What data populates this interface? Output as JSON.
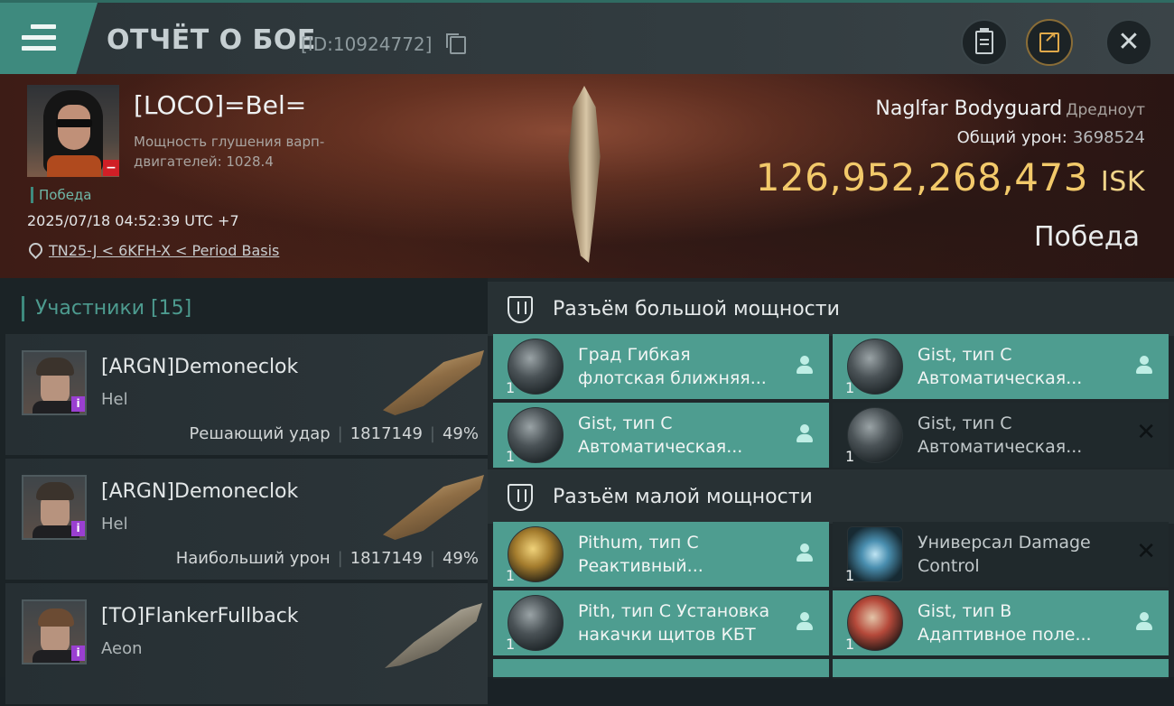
{
  "header": {
    "title": "ОТЧЁТ О БОЕ",
    "report_id": "[ID:10924772]"
  },
  "victim": {
    "pilot_name": "[LOCO]=Bel=",
    "stat_label": "Мощность глушения варп-двигателей: 1028.4",
    "result_tag": "Победа",
    "datetime": "2025/07/18 04:52:39 UTC +7",
    "location": "TN25-J < 6KFH-X < Period Basis",
    "ship_name": "Naglfar Bodyguard",
    "ship_class": "Дредноут",
    "total_damage_label": "Общий урон:",
    "total_damage": "3698524",
    "isk_value": "126,952,268,473",
    "isk_unit": "ISK",
    "result": "Победа"
  },
  "participants": {
    "header": "Участники [15]",
    "items": [
      {
        "name": "[ARGN]Demoneclok",
        "ship": "Hel",
        "role": "Решающий удар",
        "damage": "1817149",
        "percent": "49%"
      },
      {
        "name": "[ARGN]Demoneclok",
        "ship": "Hel",
        "role": "Наибольший урон",
        "damage": "1817149",
        "percent": "49%"
      },
      {
        "name": "[TO]FlankerFullback",
        "ship": "Aeon",
        "role": "",
        "damage": "",
        "percent": ""
      }
    ]
  },
  "slots": {
    "high": {
      "title": "Разъём большой мощности",
      "modules": [
        {
          "qty": "1",
          "name": "Град Гибкая",
          "desc": "флотская ближняя...",
          "state": "person-icon"
        },
        {
          "qty": "1",
          "name": "Gist, тип C",
          "desc": "Автоматическая...",
          "state": "person-icon"
        },
        {
          "qty": "1",
          "name": "Gist, тип C",
          "desc": "Автоматическая...",
          "state": "person-icon"
        },
        {
          "qty": "1",
          "name": "Gist, тип C",
          "desc": "Автоматическая...",
          "state": "destroyed-x-icon"
        }
      ]
    },
    "low": {
      "title": "Разъём малой мощности",
      "modules": [
        {
          "qty": "1",
          "name": "Pithum, тип C",
          "desc": "Реактивный...",
          "state": "person-icon"
        },
        {
          "qty": "1",
          "name": "Универсал Damage",
          "desc": "Control",
          "state": "destroyed-x-icon"
        },
        {
          "qty": "1",
          "name": "Pith, тип C Установка",
          "desc": "накачки щитов КБТ",
          "state": "person-icon"
        },
        {
          "qty": "1",
          "name": "Gist, тип B",
          "desc": "Адаптивное поле...",
          "state": "person-icon"
        }
      ]
    }
  },
  "colors": {
    "accent_teal": "#3e8a7e",
    "module_active": "#4e9d90",
    "isk_gold": "#f2c96a",
    "alert_red": "#d01f26",
    "badge_purple": "#9a3fd1"
  }
}
